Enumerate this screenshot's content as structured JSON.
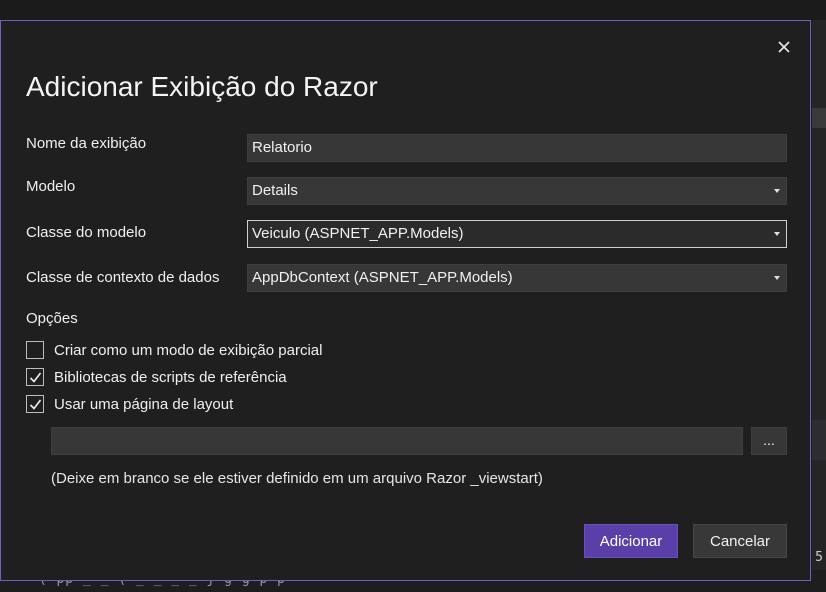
{
  "background": {
    "bottom_code_text": "ʻ(  pp  _   _   (   _   _   _   _   j   g   g              p                     p",
    "right_edge_glyphs": [
      "5",
      "r"
    ]
  },
  "dialog": {
    "title": "Adicionar Exibição do Razor",
    "close_icon": "close-icon",
    "fields": {
      "view_name": {
        "label": "Nome da exibição",
        "value": "Relatorio"
      },
      "template": {
        "label": "Modelo",
        "value": "Details"
      },
      "model_class": {
        "label": "Classe do modelo",
        "value": "Veiculo (ASPNET_APP.Models)"
      },
      "data_context": {
        "label": "Classe de contexto de dados",
        "value": "AppDbContext (ASPNET_APP.Models)"
      }
    },
    "options": {
      "label": "Opções",
      "partial_view": {
        "label": "Criar como um modo de exibição parcial",
        "checked": false
      },
      "script_libraries": {
        "label": "Bibliotecas de scripts de referência",
        "checked": true
      },
      "use_layout": {
        "label": "Usar uma página de layout",
        "checked": true
      }
    },
    "layout": {
      "path_value": "",
      "browse_label": "...",
      "hint": "(Deixe em branco se ele estiver definido em um arquivo Razor _viewstart)"
    },
    "buttons": {
      "add": "Adicionar",
      "cancel": "Cancelar"
    },
    "colors": {
      "accent": "#5b3fa8",
      "dialog_border": "#6c5fc7",
      "dialog_bg": "#1f1f1f",
      "input_bg": "#373737"
    }
  }
}
